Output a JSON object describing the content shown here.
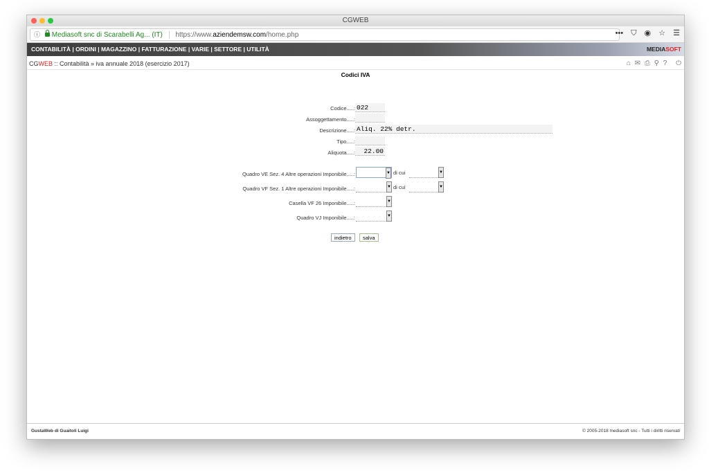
{
  "window": {
    "title": "CGWEB"
  },
  "browser": {
    "site_identity": "Mediasoft snc di Scarabelli Ag... (IT)",
    "url_prefix": "https://www.",
    "url_domain": "aziendemsw.com",
    "url_path": "/home.php"
  },
  "menu": {
    "items": [
      "CONTABILITÀ",
      "ORDINI",
      "MAGAZZINO",
      "FATTURAZIONE",
      "VARIE",
      "SETTORE",
      "UTILITÀ"
    ],
    "separator": " | ",
    "brand_a": "MEDIA",
    "brand_b": "SOFT"
  },
  "breadcrumb": {
    "cg": "CG",
    "web": "WEB",
    "path": " :: Contabilità » iva annuale 2018 (esercizio 2017)"
  },
  "page": {
    "title": "Codici IVA"
  },
  "form": {
    "codice_label": "Codice.....:",
    "codice_value": "022",
    "assoggettamento_label": "Assoggettamento.....:",
    "assoggettamento_value": "",
    "descrizione_label": "Descrizione.....:",
    "descrizione_value": "Aliq. 22% detr.",
    "tipo_label": "Tipo.....:",
    "tipo_value": "",
    "aliquota_label": "Aliquota.....:",
    "aliquota_value": "22.00",
    "quadro_ve_label": "Quadro VE Sez. 4 Altre operazioni Imponibile.....:",
    "quadro_vf_label": "Quadro VF Sez. 1 Altre operazioni Imponibile.....:",
    "casella_vf26_label": "Casella VF 26 Imponibile.....:",
    "quadro_vj_label": "Quadro VJ Imponibile.....:",
    "di_cui": "di cui"
  },
  "buttons": {
    "back": "indietro",
    "save": "salva"
  },
  "footer": {
    "left": "GustaWeb di Guaitoli Luigi",
    "right": "© 2005-2018 mediasoft snc - Tutti i diritti riservati"
  },
  "colors": {
    "menu_bg": "#444444",
    "accent_red": "#dd2222",
    "secure_green": "#1e8c1e"
  },
  "icons": [
    "info-icon",
    "lock-icon",
    "more-icon",
    "pocket-icon",
    "extension-icon",
    "bookmark-star-icon",
    "hamburger-menu-icon",
    "home-icon",
    "mail-icon",
    "print-icon",
    "search-icon",
    "help-icon",
    "power-icon"
  ]
}
